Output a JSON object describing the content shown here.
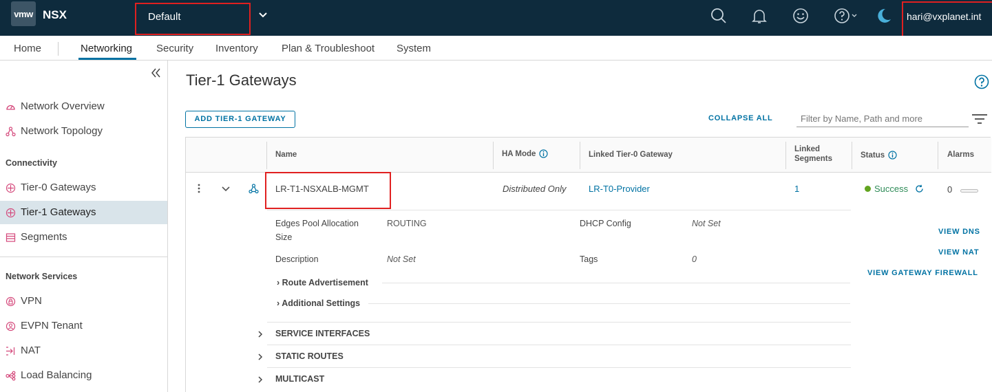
{
  "header": {
    "logo_text": "vmw",
    "app_name": "NSX",
    "project": "Default",
    "user": "hari@vxplanet.int",
    "icons": [
      "search-icon",
      "bell-icon",
      "smiley-icon",
      "help-icon",
      "moon-icon"
    ]
  },
  "nav": {
    "tabs": [
      {
        "label": "Home"
      },
      {
        "label": "Networking"
      },
      {
        "label": "Security"
      },
      {
        "label": "Inventory"
      },
      {
        "label": "Plan & Troubleshoot"
      },
      {
        "label": "System"
      }
    ],
    "active": "Networking"
  },
  "sidebar": {
    "items": [
      {
        "label": "Network Overview",
        "icon": "gauge-icon"
      },
      {
        "label": "Network Topology",
        "icon": "topology-icon"
      },
      {
        "label": "Tier-0 Gateways",
        "icon": "gateway-icon"
      },
      {
        "label": "Tier-1 Gateways",
        "icon": "gateway-icon"
      },
      {
        "label": "Segments",
        "icon": "segments-icon"
      },
      {
        "label": "VPN",
        "icon": "lock-icon"
      },
      {
        "label": "EVPN Tenant",
        "icon": "tenant-icon"
      },
      {
        "label": "NAT",
        "icon": "nat-icon"
      },
      {
        "label": "Load Balancing",
        "icon": "load-balancing-icon"
      }
    ],
    "sections": {
      "connectivity": "Connectivity",
      "network_services": "Network Services"
    },
    "selected": "Tier-1 Gateways"
  },
  "main": {
    "title": "Tier-1 Gateways",
    "add_button": "ADD TIER-1 GATEWAY",
    "collapse_all": "COLLAPSE ALL",
    "filter_placeholder": "Filter by Name, Path and more",
    "columns": {
      "name": "Name",
      "ha_mode": "HA Mode",
      "linked_t0": "Linked Tier-0 Gateway",
      "linked_segments_1": "Linked",
      "linked_segments_2": "Segments",
      "status": "Status",
      "alarms": "Alarms"
    },
    "row": {
      "name": "LR-T1-NSXALB-MGMT",
      "ha_mode": "Distributed Only",
      "linked_t0": "LR-T0-Provider",
      "linked_segments": "1",
      "status": "Success",
      "alarms": "0"
    },
    "details": {
      "edges_pool_label_1": "Edges Pool Allocation",
      "edges_pool_label_2": "Size",
      "edges_pool_value": "ROUTING",
      "dhcp_label": "DHCP Config",
      "dhcp_value": "Not Set",
      "description_label": "Description",
      "description_value": "Not Set",
      "tags_label": "Tags",
      "tags_value": "0",
      "route_adv": "Route Advertisement",
      "additional": "Additional Settings",
      "view_dns": "VIEW DNS",
      "view_nat": "VIEW NAT",
      "view_fw": "VIEW GATEWAY FIREWALL"
    },
    "sections": [
      "SERVICE INTERFACES",
      "STATIC ROUTES",
      "MULTICAST"
    ]
  },
  "colors": {
    "header_bg": "#0e2b3d",
    "accent": "#0072a3",
    "highlight": "#e02020",
    "success": "#62a420",
    "selected_bg": "#d9e4ea"
  }
}
